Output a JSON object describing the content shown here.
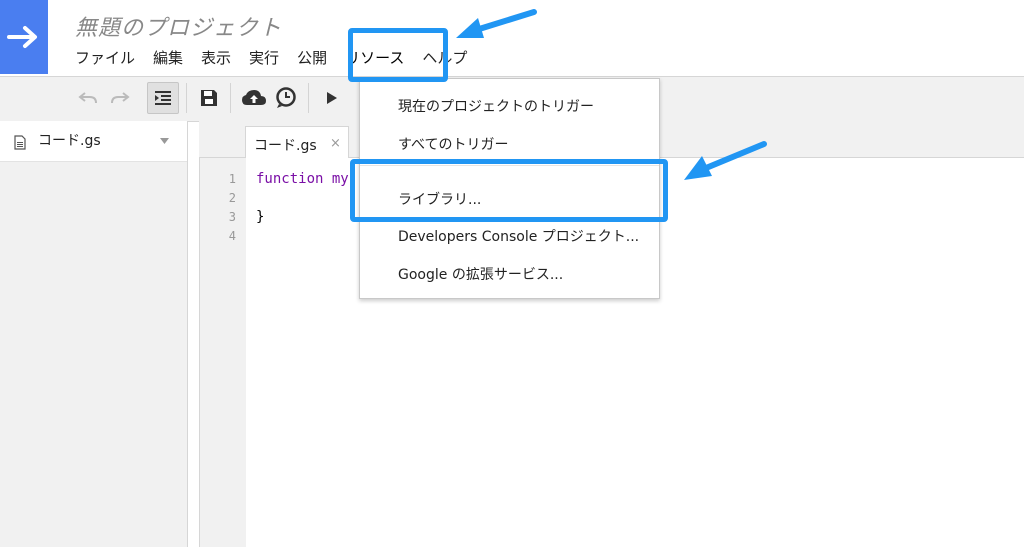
{
  "header": {
    "project_title": "無題のプロジェクト",
    "menu": [
      "ファイル",
      "編集",
      "表示",
      "実行",
      "公開",
      "リソース",
      "ヘルプ"
    ]
  },
  "toolbar": {
    "icons": [
      "undo-icon",
      "redo-icon",
      "indent-icon",
      "save-icon",
      "cloud-upload-icon",
      "clock-trigger-icon",
      "run-icon"
    ]
  },
  "sidebar": {
    "file_name": "コード.gs"
  },
  "editor": {
    "tab_label": "コード.gs",
    "tab_close": "×",
    "line_numbers": [
      "1",
      "2",
      "3",
      "4"
    ],
    "code_line1": "function my",
    "code_line3": "}"
  },
  "resource_menu": {
    "items": [
      "現在のプロジェクトのトリガー",
      "すべてのトリガー",
      "ライブラリ...",
      "Developers Console プロジェクト...",
      "Google の拡張サービス..."
    ]
  },
  "colors": {
    "accent": "#4a7ef0",
    "highlight": "#2196f3",
    "keyword": "#7a0fa6"
  }
}
